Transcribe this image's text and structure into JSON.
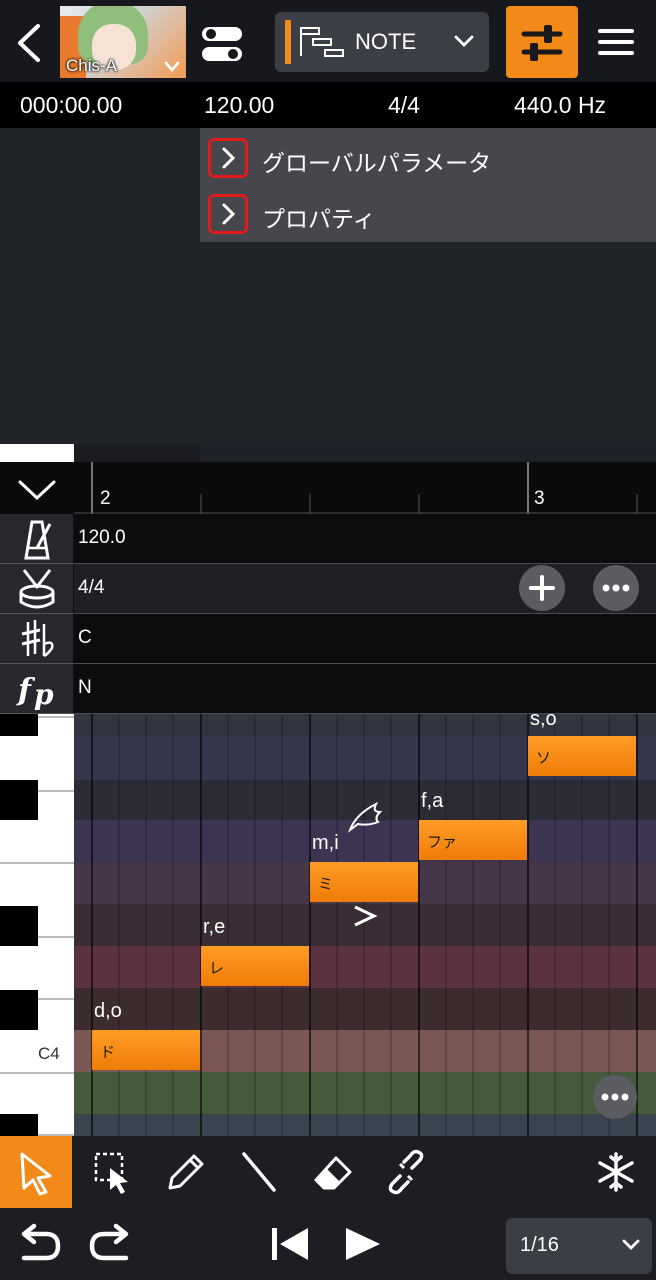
{
  "header": {
    "voice_name": "Chis-A",
    "track_label": "NOTE"
  },
  "info": {
    "time": "000:00.00",
    "tempo": "120.00",
    "time_signature": "4/4",
    "pitch_ref": "440.0 Hz"
  },
  "panel": {
    "items": [
      {
        "label": "グローバルパラメータ"
      },
      {
        "label": "プロパティ"
      }
    ]
  },
  "ruler": {
    "measure_2": "2",
    "measure_3": "3"
  },
  "lanes": {
    "tempo": "120.0",
    "time_signature": "4/4",
    "key": "C",
    "dynamics": "N"
  },
  "piano": {
    "c4_label": "C4"
  },
  "notes": [
    {
      "lyric": "ド",
      "phoneme": "d,o"
    },
    {
      "lyric": "レ",
      "phoneme": "r,e"
    },
    {
      "lyric": "ミ",
      "phoneme": "m,i"
    },
    {
      "lyric": "ファ",
      "phoneme": "f,a"
    },
    {
      "lyric": "ソ",
      "phoneme": "s,o"
    }
  ],
  "bottom": {
    "quantize": "1/16"
  },
  "colors": {
    "accent": "#f28a1a",
    "panel_bg": "#45474c",
    "highlight_border": "#e21b1b",
    "note_fill": "#ff9c26"
  },
  "icons": {
    "back": "chevron-left-icon",
    "toggle": "toggle-icon",
    "mixer": "sliders-icon",
    "menu": "hamburger-icon",
    "metronome": "metronome-icon",
    "drum": "drum-icon",
    "key": "sharp-flat-icon",
    "dynamics": "fp-icon",
    "freeze": "snowflake-icon"
  }
}
